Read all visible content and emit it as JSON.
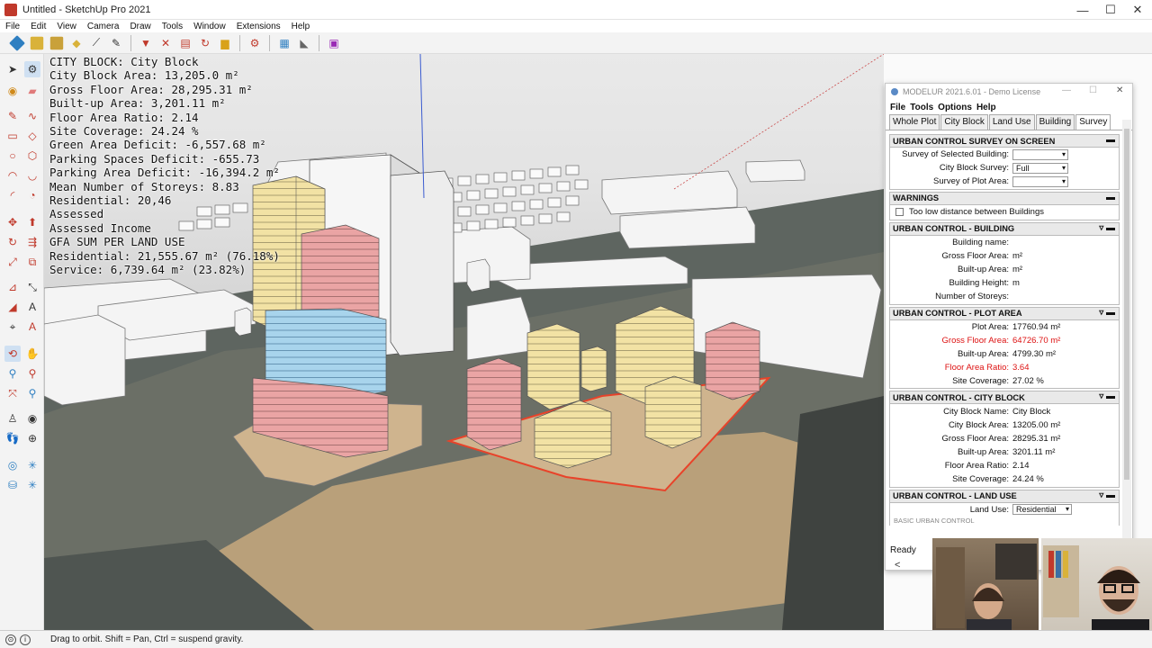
{
  "window": {
    "title": "Untitled - SketchUp Pro 2021",
    "minimize": "—",
    "maximize": "☐",
    "close": "✕"
  },
  "menu": [
    "File",
    "Edit",
    "View",
    "Camera",
    "Draw",
    "Tools",
    "Window",
    "Extensions",
    "Help"
  ],
  "overlay": {
    "lines": [
      "CITY BLOCK: City Block",
      "City Block Area: 13,205.0 m²",
      "Gross Floor Area: 28,295.31 m²",
      "Built-up Area: 3,201.11 m²",
      "Floor Area Ratio: 2.14",
      "Site Coverage: 24.24 %",
      "Green Area Deficit: -6,557.68 m²",
      "Parking Spaces Deficit: -655.73",
      "Parking Area Deficit: -16,394.2 m²",
      "Mean Number of Storeys: 8.83",
      "Residential: 20,46",
      "Assessed",
      "Assessed Income",
      "GFA SUM PER LAND USE",
      "Residential: 21,555.67 m² (76.18%)",
      "Service: 6,739.64 m² (23.82%)"
    ]
  },
  "status": {
    "message": "Drag to orbit. Shift = Pan, Ctrl = suspend gravity."
  },
  "modelur": {
    "title": "MODELUR 2021.6.01 - Demo License",
    "menu": [
      "File",
      "Tools",
      "Options",
      "Help"
    ],
    "tabs": [
      "Whole Plot",
      "City Block",
      "Land Use",
      "Building",
      "Survey"
    ],
    "active_tab": "Survey",
    "survey": {
      "header": "URBAN CONTROL SURVEY ON SCREEN",
      "rows": [
        {
          "label": "Survey of Selected Building:",
          "value": ""
        },
        {
          "label": "City Block Survey:",
          "value": "Full"
        },
        {
          "label": "Survey of Plot Area:",
          "value": ""
        }
      ]
    },
    "warnings": {
      "header": "WARNINGS",
      "item": "Too low distance between Buildings"
    },
    "building": {
      "header": "URBAN CONTROL - BUILDING",
      "rows": [
        {
          "label": "Building name:",
          "value": ""
        },
        {
          "label": "Gross Floor Area:",
          "value": "m²"
        },
        {
          "label": "Built-up Area:",
          "value": "m²"
        },
        {
          "label": "Building Height:",
          "value": "m"
        },
        {
          "label": "Number of Storeys:",
          "value": ""
        }
      ]
    },
    "plot": {
      "header": "URBAN CONTROL - PLOT AREA",
      "rows": [
        {
          "label": "Plot Area:",
          "value": "17760.94 m²"
        },
        {
          "label": "Gross Floor Area:",
          "value": "64726.70 m²"
        },
        {
          "label": "Built-up Area:",
          "value": "4799.30 m²"
        },
        {
          "label": "Floor Area Ratio:",
          "value": "3.64"
        },
        {
          "label": "Site Coverage:",
          "value": "27.02 %"
        }
      ]
    },
    "cityblock": {
      "header": "URBAN CONTROL - CITY BLOCK",
      "rows": [
        {
          "label": "City Block Name:",
          "value": "City Block"
        },
        {
          "label": "City Block Area:",
          "value": "13205.00 m²"
        },
        {
          "label": "Gross Floor Area:",
          "value": "28295.31 m²"
        },
        {
          "label": "Built-up Area:",
          "value": "3201.11 m²"
        },
        {
          "label": "Floor Area Ratio:",
          "value": "2.14"
        },
        {
          "label": "Site Coverage:",
          "value": "24.24 %"
        }
      ]
    },
    "landuse": {
      "header": "URBAN CONTROL - LAND USE",
      "label": "Land Use:",
      "value": "Residential",
      "subheader": "BASIC URBAN CONTROL"
    },
    "ready": "Ready",
    "back": "<"
  },
  "colors": {
    "residential": "#f2e2a4",
    "service": "#eaa4a4",
    "office": "#a8d4ec",
    "ground": "#cfb48e",
    "plot_outline": "#e8432a",
    "warning_red": "#dd1111"
  }
}
